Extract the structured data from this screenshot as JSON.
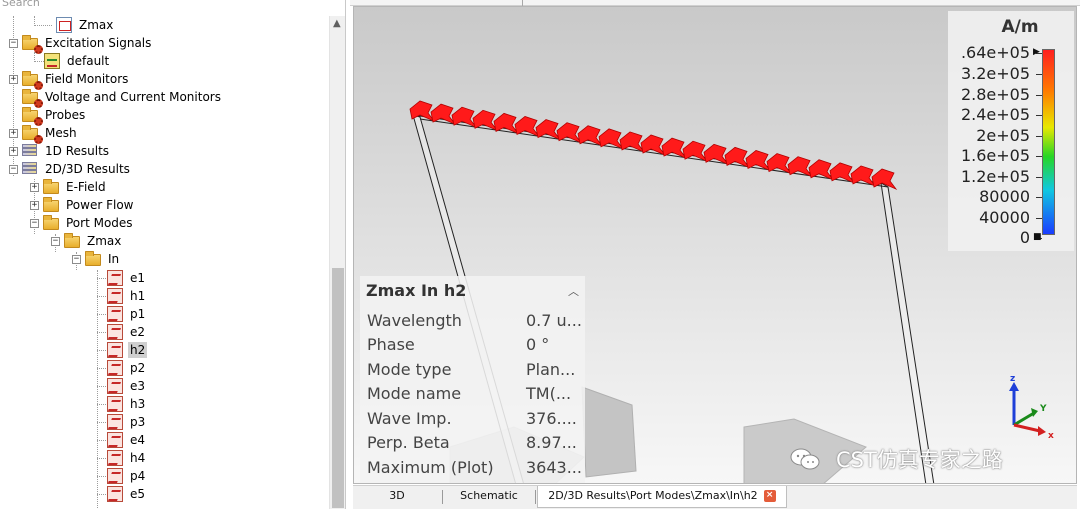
{
  "search": {
    "placeholder": "Search"
  },
  "tree": {
    "zmax_top": "Zmax",
    "excitation_signals": "Excitation Signals",
    "default": "default",
    "field_monitors": "Field Monitors",
    "voltage_current": "Voltage and Current Monitors",
    "probes": "Probes",
    "mesh": "Mesh",
    "results_1d": "1D Results",
    "results_2d3d": "2D/3D Results",
    "e_field": "E-Field",
    "power_flow": "Power Flow",
    "port_modes": "Port Modes",
    "zmax": "Zmax",
    "in": "In",
    "modes": [
      "e1",
      "h1",
      "p1",
      "e2",
      "h2",
      "p2",
      "e3",
      "h3",
      "p3",
      "e4",
      "h4",
      "p4",
      "e5"
    ],
    "selected_mode": "h2"
  },
  "legend": {
    "unit": "A/m",
    "ticks": [
      ".64e+05",
      "3.2e+05",
      "2.8e+05",
      "2.4e+05",
      "2e+05",
      "1.6e+05",
      "1.2e+05",
      "80000",
      "40000",
      "0"
    ]
  },
  "info": {
    "title": "Zmax In h2",
    "rows": [
      {
        "key": "Wavelength",
        "value": "0.7 u..."
      },
      {
        "key": "Phase",
        "value": "0 °"
      },
      {
        "key": "Mode type",
        "value": "Plan..."
      },
      {
        "key": "Mode name",
        "value": "TM(..."
      },
      {
        "key": "Wave Imp.",
        "value": "376...."
      },
      {
        "key": "Perp. Beta",
        "value": "8.97..."
      },
      {
        "key": "Maximum (Plot)",
        "value": "3643..."
      }
    ]
  },
  "axes": {
    "z": "z",
    "y": "Y",
    "x": "x"
  },
  "watermark": "CST仿真专家之路",
  "tabs": {
    "t3d": "3D",
    "schematic": "Schematic",
    "active": "2D/3D Results\\Port Modes\\Zmax\\In\\h2"
  },
  "colors": {
    "arrow": "#ff1a1a",
    "selection": "#cfcfcf",
    "tab_close": "#e45c3a"
  }
}
